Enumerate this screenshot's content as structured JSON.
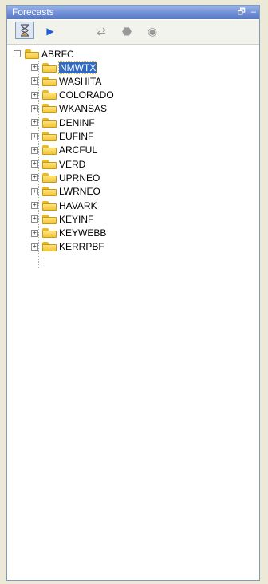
{
  "panel": {
    "title": "Forecasts",
    "restore_label": "🗗",
    "minimize_label": "–"
  },
  "toolbar": {
    "buttons": [
      {
        "icon": "hourglass-icon"
      },
      {
        "icon": "play-icon"
      },
      {
        "icon": "refresh-icon"
      },
      {
        "icon": "stop-icon"
      },
      {
        "icon": "export-icon"
      }
    ]
  },
  "tree": {
    "root": {
      "label": "ABRFC",
      "expander": "−"
    },
    "children": [
      {
        "label": "NMWTX",
        "selected": true
      },
      {
        "label": "WASHITA"
      },
      {
        "label": "COLORADO"
      },
      {
        "label": "WKANSAS"
      },
      {
        "label": "DENINF"
      },
      {
        "label": "EUFINF"
      },
      {
        "label": "ARCFUL"
      },
      {
        "label": "VERD"
      },
      {
        "label": "UPRNEO"
      },
      {
        "label": "LWRNEO"
      },
      {
        "label": "HAVARK"
      },
      {
        "label": "KEYINF"
      },
      {
        "label": "KEYWEBB"
      },
      {
        "label": "KERRPBF"
      }
    ],
    "child_expander": "+"
  }
}
